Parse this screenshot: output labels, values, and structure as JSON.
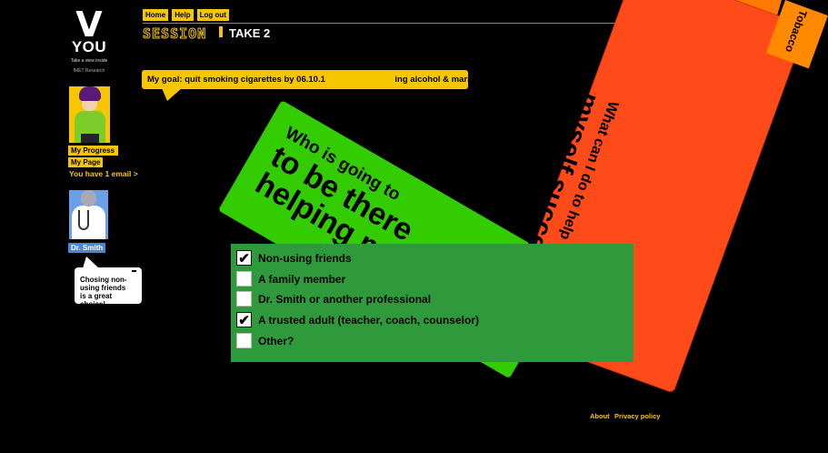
{
  "logo": {
    "v": "V",
    "you": "YOU",
    "tagline": "Take a view inside",
    "org": "IMET Research"
  },
  "nav": {
    "home": "Home",
    "help": "Help",
    "logout": "Log out"
  },
  "session": {
    "title": "SESSION",
    "take": "TAKE 2"
  },
  "goal": {
    "text": "My goal: quit smoking cigarettes by 06.10.1                             ing alcohol & marijuana"
  },
  "sidebar": {
    "my_progress": "My Progress",
    "my_page": "My Page",
    "email": "You have 1 email >",
    "doctor_name": "Dr. Smith",
    "doctor_bubble": [
      "Chosing non-",
      "using friends",
      "is a great choice!"
    ]
  },
  "green_card": {
    "line1": "Who is going to",
    "line2": "to be there",
    "line3": "helping me?"
  },
  "orange_card": {
    "line1": "What can I do to help",
    "line2": "myself succeed?",
    "tab": "Tobacco"
  },
  "checklist": [
    {
      "label": "Non-using friends",
      "checked": true
    },
    {
      "label": "A family member",
      "checked": false
    },
    {
      "label": "Dr. Smith or another professional",
      "checked": false
    },
    {
      "label": "A trusted adult (teacher, coach, counselor)",
      "checked": true
    },
    {
      "label": "Other?",
      "checked": false
    }
  ],
  "footer": {
    "about": "About",
    "privacy": "Privacy policy"
  },
  "colors": {
    "accent": "#f7c600",
    "green_card": "#33cc00",
    "panel": "#2f9a3c",
    "orange_card": "#ff4a1a"
  }
}
